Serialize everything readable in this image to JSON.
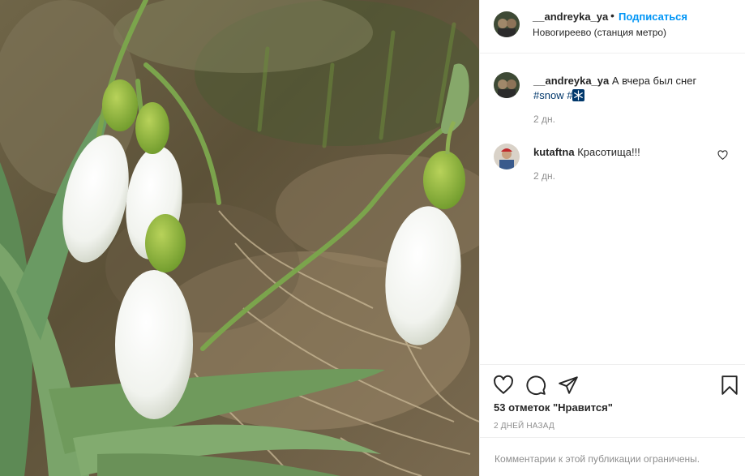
{
  "photo": {
    "subject": "snowdrops-photo"
  },
  "header": {
    "username": "__andreyka_ya",
    "separator": "•",
    "follow_label": "Подписаться",
    "location": "Новогиреево (станция метро)"
  },
  "caption": {
    "username": "__andreyka_ya",
    "text": "А вчера был снег",
    "hashtag": "#snow",
    "hashtag2": "#",
    "time": "2 дн."
  },
  "comments": [
    {
      "username": "kutaftna",
      "text": "Красотища!!!",
      "time": "2 дн."
    }
  ],
  "actions": {
    "like_icon": "heart-icon",
    "comment_icon": "comment-icon",
    "share_icon": "send-icon",
    "save_icon": "bookmark-icon"
  },
  "likes": "53 отметок \"Нравится\"",
  "posted": "2 ДНЕЙ НАЗАД",
  "comments_restricted": "Комментарии к этой публикации ограничены.",
  "colors": {
    "accent": "#0095f6",
    "hashtag": "#00376b",
    "muted": "#8e8e8e",
    "border": "#efefef"
  }
}
